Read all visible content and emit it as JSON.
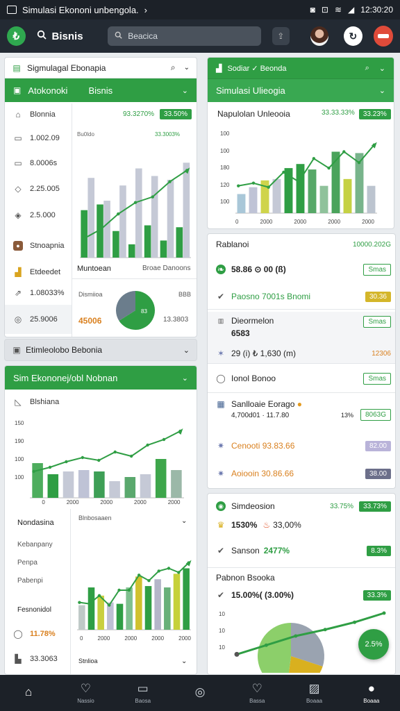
{
  "status": {
    "app_title": "Simulasi Ekononi unbengola.",
    "time": "12:30:20"
  },
  "appbar": {
    "logo_glyph": "₺",
    "title": "Bisnis",
    "search_placeholder": "Beacica"
  },
  "left_card": {
    "header_title": "Sigmulagal Ebonapia",
    "green_tab_left": "Atokonoki",
    "green_tab_right": "Bisnis",
    "side_items": [
      {
        "icon": "home-icon",
        "label": "Blonnia"
      },
      {
        "icon": "document-icon",
        "label": "1.002.09"
      },
      {
        "icon": "document-icon",
        "label": "8.0006s"
      },
      {
        "icon": "tag-icon",
        "label": "2.25.005"
      },
      {
        "icon": "tag-icon",
        "label": "2.5.000"
      },
      {
        "icon": "user-icon",
        "label": "Stnoapnia"
      },
      {
        "icon": "chart-icon",
        "label": "Etdeedet"
      }
    ],
    "chart_summary_left": "93.3270%",
    "chart_summary_right": "33.50%",
    "chart_caption_left": "Bu0ldo",
    "chart_caption_right": "33.3003%",
    "chart_footer_left": "Muntoean",
    "chart_footer_right": "Broae Danoons",
    "bottom_rows": [
      {
        "icon": "trend-icon",
        "label": "1.08033%"
      },
      {
        "icon": "clock-icon",
        "label": "25.9006"
      }
    ],
    "donut_title": "Dismiioa",
    "donut_corner": "BBB",
    "donut_left_value": "45006",
    "donut_right_value": "13.3803",
    "donut_center": "83"
  },
  "collapsed_panel": {
    "title": "Etimleolobo Bebonia"
  },
  "left_card2": {
    "header_title": "Sim Ekononej/obl Nobnan",
    "side_label_top": "Blshiana",
    "y_ticks": [
      "150",
      "190",
      "100",
      "100",
      "0"
    ],
    "x_ticks": [
      "2000",
      "2000",
      "2000",
      "2000"
    ],
    "list_title": "Nondasina",
    "list_items": [
      "Kebanpany",
      "Penpa",
      "Pabenpi"
    ],
    "list_footer_title": "Fesnonidol",
    "percent_value": "11.78%",
    "count_value": "33.3063",
    "sub_chart_label": "Blnbosaaen",
    "sub_chart_footer": "Stnlioa",
    "sub_x_ticks": [
      "0",
      "2000",
      "2000",
      "2000",
      "2000"
    ]
  },
  "right_card1": {
    "header_title": "Sodiar ✓ Beonda",
    "green_title": "Simulasi Ulieogia",
    "chart_title": "Napulolan Unleooia",
    "chart_value": "33.33.33%",
    "chart_badge": "33.23%",
    "y_ticks": [
      "100",
      "100",
      "180",
      "120",
      "100",
      "0"
    ],
    "x_ticks": [
      "0",
      "2000",
      "2000",
      "2000",
      "2000"
    ]
  },
  "feed": {
    "rows": [
      {
        "type": "header",
        "title": "Rablanoi",
        "right": "10000.202G"
      },
      {
        "type": "item",
        "icon": "leaf-icon",
        "text": "58.86 ⊙ 00 (ß)",
        "badge": "Smas",
        "badge_style": "pill-outline"
      },
      {
        "type": "item",
        "icon": "check-icon",
        "text": "Paosno 7001s Bnomi",
        "badge": "30.36",
        "badge_style": "pill-yellow"
      },
      {
        "type": "item2",
        "icon": "bar-icon",
        "text": "Dieormelon",
        "sub": "6583",
        "badge": "Smas",
        "badge_style": "pill-outline"
      },
      {
        "type": "item",
        "icon": "star-icon",
        "text": "29 (i) ₺ 1,630 (m)",
        "badge": "12306",
        "badge_style": "orange-text"
      },
      {
        "type": "item",
        "icon": "chat-icon",
        "text": "Ionol Bonoo",
        "badge": "Smas",
        "badge_style": "pill-outline"
      },
      {
        "type": "item2",
        "icon": "grid-icon",
        "text": "Sanlloaie Eorago",
        "sub": "4,700d01 · 11.7.80",
        "badge": "8063G",
        "badge_style": "pill-outline",
        "pre": "13%"
      },
      {
        "type": "item",
        "icon": "gear-icon",
        "text": "Cenooti 93.83.66",
        "badge": "82.00",
        "badge_style": "pill-lav"
      },
      {
        "type": "item",
        "icon": "gear-icon",
        "text": "Aoiooin 30.86.66",
        "badge": "38.00",
        "badge_style": "pill-gray"
      }
    ]
  },
  "right_card3": {
    "title": "Simdeosion",
    "title_value": "33.75%",
    "title_badge": "33.73%",
    "row1_left": "1530%",
    "row1_right": "33,00%",
    "row2_label": "Sanson",
    "row2_value": "2477%",
    "row2_badge": "8.3%",
    "section_title": "Pabnon Bsooka",
    "row3_value": "15.00%( (3.00%)",
    "row3_badge": "33.3%",
    "y_ticks": [
      "10",
      "10",
      "10"
    ],
    "fab": "2.5%"
  },
  "bottomnav": {
    "items": [
      {
        "label": "",
        "icon": "home-icon"
      },
      {
        "label": "Nassio",
        "icon": "heart-icon"
      },
      {
        "label": "Baosa",
        "icon": "chart-icon"
      },
      {
        "label": "",
        "icon": "compass-icon"
      },
      {
        "label": "Bassa",
        "icon": "heart-icon"
      },
      {
        "label": "Boaaa",
        "icon": "image-icon"
      },
      {
        "label": "Boaaa",
        "icon": "user-icon"
      }
    ]
  },
  "chart_data": [
    {
      "type": "bar",
      "title": "",
      "categories": [
        "1",
        "2",
        "3",
        "4",
        "5",
        "6",
        "7"
      ],
      "series": [
        {
          "values": [
            50,
            56,
            28,
            14,
            34,
            18,
            32
          ],
          "color": "#2f9e44"
        },
        {
          "values": [
            84,
            60,
            76,
            94,
            86,
            82,
            100
          ],
          "color": "#c5c9d6"
        }
      ],
      "line": [
        20,
        30,
        46,
        58,
        64,
        80,
        92
      ],
      "ylim": [
        0,
        120
      ]
    },
    {
      "type": "pie",
      "values": [
        66,
        34
      ],
      "colors": [
        "#2f9e44",
        "#6b7d8c"
      ]
    },
    {
      "type": "bar",
      "categories": [
        "1",
        "2",
        "3",
        "4",
        "5",
        "6",
        "7",
        "8",
        "9",
        "10"
      ],
      "values": [
        50,
        34,
        38,
        40,
        38,
        24,
        30,
        34,
        56,
        40
      ],
      "colors": [
        "#4dad5d",
        "#2f9e44",
        "#c5c9d6",
        "#bfc3d6",
        "#3e9f56",
        "#c5c9d6",
        "#5aa86d",
        "#c5c9d6",
        "#3ea64b",
        "#9bb8a8"
      ],
      "line": [
        38,
        44,
        52,
        58,
        54,
        66,
        60,
        76,
        84,
        96
      ],
      "ylim": [
        0,
        120
      ]
    },
    {
      "type": "bar",
      "categories": [
        "1",
        "2",
        "3",
        "4",
        "5",
        "6",
        "7",
        "8",
        "9",
        "10",
        "11",
        "12"
      ],
      "values": [
        36,
        62,
        50,
        40,
        38,
        62,
        78,
        64,
        74,
        62,
        82,
        90
      ],
      "colors": [
        "#bfc9c7",
        "#2f9e44",
        "#c9cf3f",
        "#bec0d4",
        "#2f9e44",
        "#7fc08f",
        "#d0c12e",
        "#2f9e44",
        "#b5b6c9",
        "#68b079",
        "#c6d13a",
        "#2f9e44"
      ],
      "line": [
        40,
        38,
        50,
        36,
        58,
        58,
        80,
        72,
        86,
        90,
        84,
        98
      ],
      "ylim": [
        0,
        120
      ]
    },
    {
      "type": "bar",
      "categories": [
        "1",
        "2",
        "3",
        "4",
        "5",
        "6",
        "7",
        "8",
        "9",
        "10",
        "11",
        "12"
      ],
      "values": [
        28,
        38,
        48,
        50,
        66,
        72,
        64,
        40,
        90,
        50,
        88,
        40
      ],
      "colors": [
        "#a9c7d8",
        "#bfc3d6",
        "#cfd44b",
        "#c5c9d6",
        "#2f9e44",
        "#2f9e44",
        "#57a868",
        "#8fc29b",
        "#4aa35b",
        "#c5d143",
        "#78b48b",
        "#bcc4cf"
      ],
      "line": [
        40,
        44,
        38,
        60,
        46,
        80,
        66,
        90,
        74,
        100
      ],
      "ylim": [
        0,
        120
      ]
    },
    {
      "type": "pie",
      "values": [
        30,
        22,
        48
      ],
      "colors": [
        "#9aa3b0",
        "#d9b01f",
        "#8ccf6a"
      ],
      "line": [
        10,
        30,
        50,
        64,
        80,
        100
      ]
    }
  ]
}
